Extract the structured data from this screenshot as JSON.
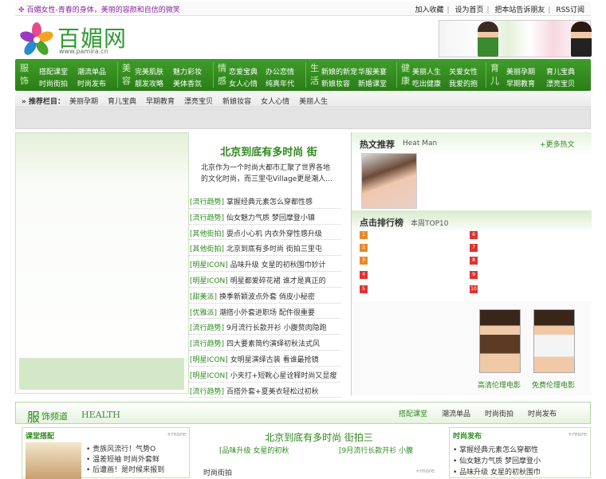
{
  "top": {
    "slogan": "百媚女性-青春的身体，美丽的容颜和自信的微笑",
    "links": [
      "加入收藏",
      "设为首页",
      "把本站告诉朋友",
      "RSS订阅"
    ]
  },
  "logo": {
    "name": "百媚网",
    "url": "www.pamira.cn"
  },
  "nav": {
    "groups": [
      {
        "big": "服饰",
        "items": [
          "搭配课堂",
          "潮流单品",
          "时尚街拍",
          "时尚发布"
        ]
      },
      {
        "big": "美容",
        "items": [
          "完美肌肤",
          "魅力彩妆",
          "靓发攻略",
          "美体香氛"
        ]
      },
      {
        "big": "情感",
        "items": [
          "恋爱宝典",
          "办公恋情",
          "女人心情",
          "纯真年代"
        ]
      },
      {
        "big": "生活",
        "items": [
          "新娘的新宠",
          "华服美宴",
          "新娘妆容",
          "新婚课堂"
        ]
      },
      {
        "big": "健康",
        "items": [
          "美丽人生",
          "关爱女性",
          "吃出健康",
          "我爱的抱"
        ]
      },
      {
        "big": "育儿",
        "items": [
          "美丽孕期",
          "育儿宝典",
          "早期教育",
          "漂亮宝贝"
        ]
      }
    ]
  },
  "recommend": {
    "label": "推荐栏目：",
    "links": [
      "美丽孕期",
      "育儿宝典",
      "早期教育",
      "漂亮宝贝",
      "新娘妆容",
      "女人心情",
      "美丽人生"
    ]
  },
  "center": {
    "headline": "北京到底有多时尚 街",
    "summary": "北京作为一个时尚大都市汇聚了世界各地的文化时尚，而三里屯Village更是潮人...",
    "list": [
      {
        "tag": "[流行趋势]",
        "title": "掌握经典元素怎么穿都性感"
      },
      {
        "tag": "[流行趋势]",
        "title": "仙女魅力气质 梦回摩登小镇"
      },
      {
        "tag": "[其他街拍]",
        "title": "耍点小心机 内衣外穿性感升级"
      },
      {
        "tag": "[其他街拍]",
        "title": "北京到底有多时尚 街拍三里屯"
      },
      {
        "tag": "[明星ICON]",
        "title": "品味升级 女星的初秋围巾妙计"
      },
      {
        "tag": "[明星ICON]",
        "title": "明星都爱碎花裙 谁才是真正的"
      },
      {
        "tag": "[甜美派]",
        "title": "换季新颖波点外套 俏皮小秘密"
      },
      {
        "tag": "[优雅派]",
        "title": "潮搭小外套进职场 配件很重要"
      },
      {
        "tag": "[流行趋势]",
        "title": "9月流行长款开衫 小腹赘肉隐跑"
      },
      {
        "tag": "[流行趋势]",
        "title": "四大要素简约演绎初秋法式风"
      },
      {
        "tag": "[明星ICON]",
        "title": "女明星演绎古装 看谁最抢镜"
      },
      {
        "tag": "[明星ICON]",
        "title": "小夹打+短靴心星诠释时尚又显瘦"
      },
      {
        "tag": "[流行趋势]",
        "title": "百搭外套+夏美衣轻松过初秋"
      }
    ]
  },
  "hot": {
    "title": "热文推荐",
    "sub": "Heat Man",
    "more": "+更多热文"
  },
  "rank": {
    "title": "点击排行榜",
    "sub": "本周TOP10",
    "nums": [
      "1",
      "2",
      "3",
      "4",
      "5",
      "6",
      "7",
      "8",
      "9",
      "10"
    ]
  },
  "models": {
    "cap1": "高清伦理电影",
    "cap2": "免费伦理电影"
  },
  "channel": {
    "big": "服",
    "rest": "饰频道",
    "en": "HEALTH",
    "tabs": [
      "搭配课堂",
      "潮流单品",
      "时尚街拍",
      "时尚发布"
    ]
  },
  "box1": {
    "title": "课堂搭配",
    "more": "+more",
    "items": [
      "• 贵族风流行！气势O",
      "• 温差短袖 时尚外套鲜",
      "• 后遭画！是时候来报到"
    ]
  },
  "box2": {
    "headline": "北京到底有多时尚 街拍三",
    "sub1": "[品味升级 女星的初秋",
    "sub2": "[9月流行长款开衫 小腹",
    "head2": "时尚街拍",
    "more": "+more"
  },
  "box3": {
    "title": "时尚发布",
    "more": "+more",
    "items": [
      "• 掌握经典元素怎么穿都性",
      "• 仙女魅力气质 梦回摩登小",
      "• 品味升级 女星的初秋围巾"
    ]
  }
}
